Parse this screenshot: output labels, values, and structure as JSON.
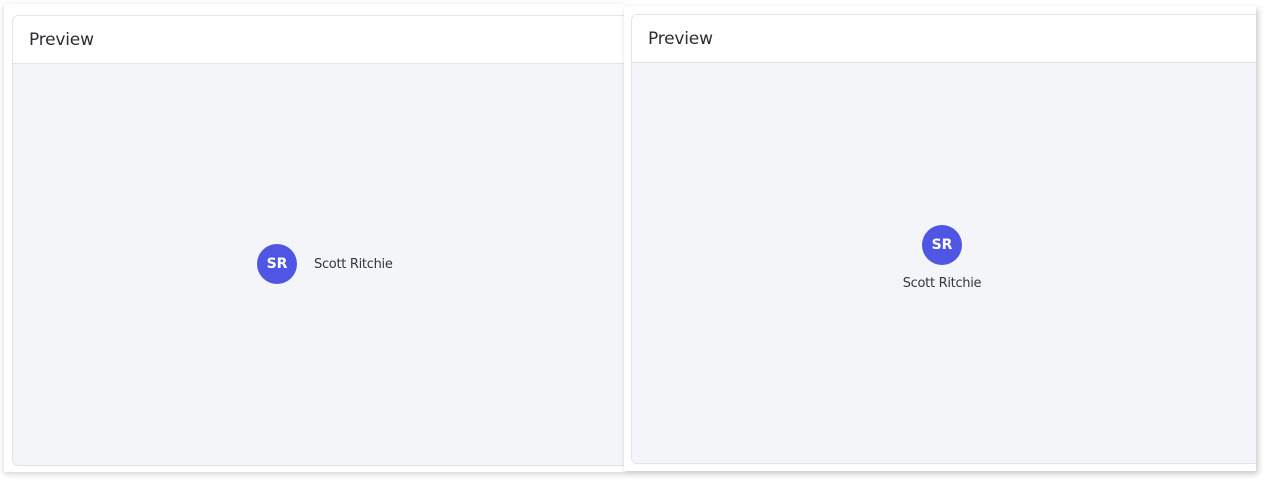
{
  "panels": [
    {
      "title": "Preview",
      "layout": "horizontal",
      "user": {
        "initials": "SR",
        "name": "Scott Ritchie"
      }
    },
    {
      "title": "Preview",
      "layout": "vertical",
      "user": {
        "initials": "SR",
        "name": "Scott Ritchie"
      }
    }
  ],
  "colors": {
    "avatar_background": "#4f56e3",
    "preview_background": "#f4f5f8",
    "border": "#e3e4e8"
  }
}
